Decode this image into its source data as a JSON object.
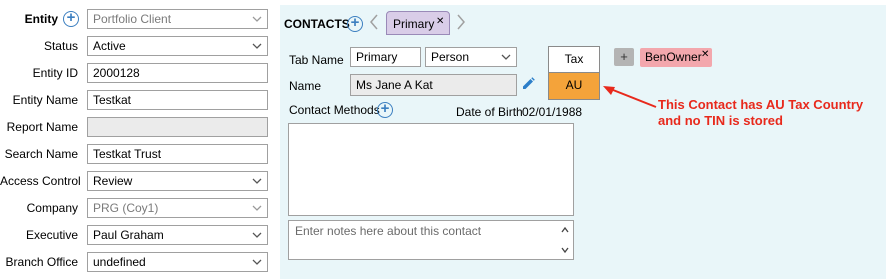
{
  "entity": {
    "label": "Entity",
    "value": "Portfolio Client",
    "fields": [
      {
        "label": "Status",
        "value": "Active",
        "type": "select"
      },
      {
        "label": "Entity ID",
        "value": "2000128",
        "type": "text"
      },
      {
        "label": "Entity Name",
        "value": "Testkat",
        "type": "text"
      },
      {
        "label": "Report Name",
        "value": "",
        "type": "readonly"
      },
      {
        "label": "Search Name",
        "value": "Testkat Trust",
        "type": "text"
      },
      {
        "label": "Access Control",
        "value": "Review",
        "type": "select"
      },
      {
        "label": "Company",
        "value": "PRG (Coy1)",
        "type": "select-disabled"
      },
      {
        "label": "Executive",
        "value": "Paul Graham",
        "type": "select"
      },
      {
        "label": "Branch Office",
        "value": "undefined",
        "type": "select"
      }
    ]
  },
  "contacts": {
    "title": "CONTACTS",
    "tabs": [
      {
        "label": "Primary",
        "close": "✕"
      }
    ],
    "tab_name_label": "Tab Name",
    "tab_name_value": "Primary",
    "contact_type": "Person",
    "name_label": "Name",
    "name_value": "Ms Jane A Kat",
    "contact_methods_label": "Contact Methods",
    "dob_label": "Date of Birth",
    "dob_value": "02/01/1988",
    "notes_placeholder": "Enter notes here about this contact",
    "tax": {
      "header": "Tax",
      "country": "AU"
    },
    "add_badge": "+",
    "badges": [
      {
        "label": "BenOwner",
        "close": "✕"
      }
    ]
  },
  "annotation": {
    "line1": "This Contact has AU Tax Country",
    "line2": "and no TIN is stored",
    "color": "#e8291c"
  },
  "icons": [
    "add-icon",
    "chevron-down-icon",
    "chevron-left-icon",
    "chevron-right-icon",
    "pencil-icon",
    "close-icon",
    "scroll-up-icon",
    "scroll-down-icon"
  ]
}
